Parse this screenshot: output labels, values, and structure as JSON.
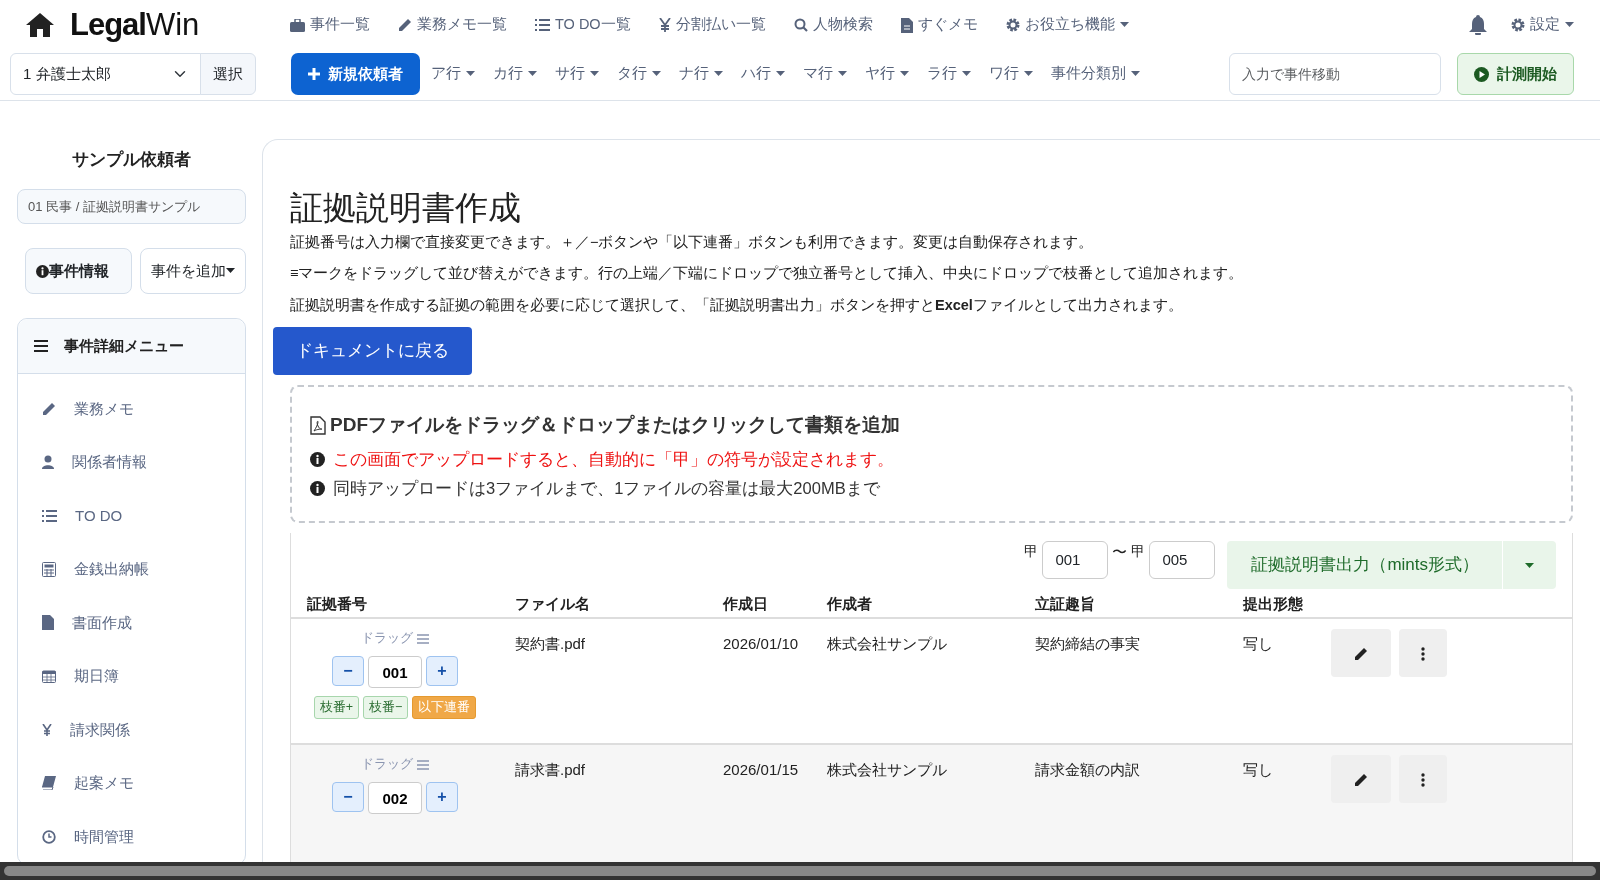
{
  "brand": {
    "bold": "Legal",
    "light": "Win"
  },
  "top_nav": [
    {
      "label": "事件一覧",
      "dropdown": false
    },
    {
      "label": "業務メモ一覧",
      "dropdown": false
    },
    {
      "label": "TO DO一覧",
      "dropdown": false
    },
    {
      "label": "分割払い一覧",
      "dropdown": false
    },
    {
      "label": "人物検索",
      "dropdown": false
    },
    {
      "label": "すぐメモ",
      "dropdown": false
    },
    {
      "label": "お役立ち機能",
      "dropdown": true
    }
  ],
  "settings_menu": "設定",
  "lawyer_select": {
    "value": "1 弁護士太郎",
    "button": "選択"
  },
  "new_client_button": "新規依頼者",
  "index_menus": [
    "ア行",
    "カ行",
    "サ行",
    "タ行",
    "ナ行",
    "ハ行",
    "マ行",
    "ヤ行",
    "ラ行",
    "ワ行",
    "事件分類別"
  ],
  "case_jump": {
    "placeholder": "入力で事件移動"
  },
  "timer_button": "計測開始",
  "sidebar": {
    "client_name": "サンプル依頼者",
    "case_label": "01 民事 / 証拠説明書サンプル",
    "case_info_button": "事件情報",
    "add_case_button": "事件を追加",
    "menu_title": "事件詳細メニュー",
    "menu_items": [
      "業務メモ",
      "関係者情報",
      "TO DO",
      "金銭出納帳",
      "書面作成",
      "期日簿",
      "請求関係",
      "起案メモ",
      "時間管理"
    ]
  },
  "main": {
    "title": "証拠説明書作成",
    "notes": [
      "証拠番号は入力欄で直接変更できます。＋／−ボタンや「以下連番」ボタンも利用できます。変更は自動保存されます。",
      "≡マークをドラッグして並び替えができます。行の上端／下端にドロップで独立番号として挿入、中央にドロップで枝番として追加されます。",
      "証拠説明書を作成する証拠の範囲を必要に応じて選択して、「証拠説明書出力」ボタンを押すと**Excel**ファイルとして出力されます。"
    ],
    "back_button": "ドキュメントに戻る",
    "dropzone": {
      "title": "PDFファイルをドラッグ＆ドロップまたはクリックして書類を追加",
      "notices": [
        {
          "text": "この画面でアップロードすると、自動的に「甲」の符号が設定されます。",
          "kind": "warning"
        },
        {
          "text": "同時アップロードは3ファイルまで、1ファイルの容量は最大200MBまで",
          "kind": "info"
        }
      ]
    },
    "range": {
      "from_prefix": "甲",
      "from": "001",
      "separator": "〜",
      "to_prefix": "甲",
      "to": "005"
    },
    "export_button": "証拠説明書出力（mints形式）",
    "table": {
      "columns": [
        "証拠番号",
        "ファイル名",
        "作成日",
        "作成者",
        "立証趣旨",
        "提出形態"
      ],
      "rows": [
        {
          "cells": [
            {
              "drag_label": "ドラッグ",
              "minus": "−",
              "number": "001",
              "plus": "+",
              "branch_buttons": [
                {
                  "label": "枝番+",
                  "kind": "branch"
                },
                {
                  "label": "枝番−",
                  "kind": "branch"
                },
                {
                  "label": "以下連番",
                  "kind": "sequence"
                }
              ]
            },
            "契約書.pdf",
            "2026/01/10",
            "株式会社サンプル",
            "契約締結の事実",
            "写し"
          ]
        },
        {
          "cells": [
            {
              "drag_label": "ドラッグ",
              "minus": "−",
              "number": "002",
              "plus": "+"
            },
            "請求書.pdf",
            "2026/01/15",
            "株式会社サンプル",
            "請求金額の内訳",
            "写し"
          ]
        }
      ]
    }
  }
}
